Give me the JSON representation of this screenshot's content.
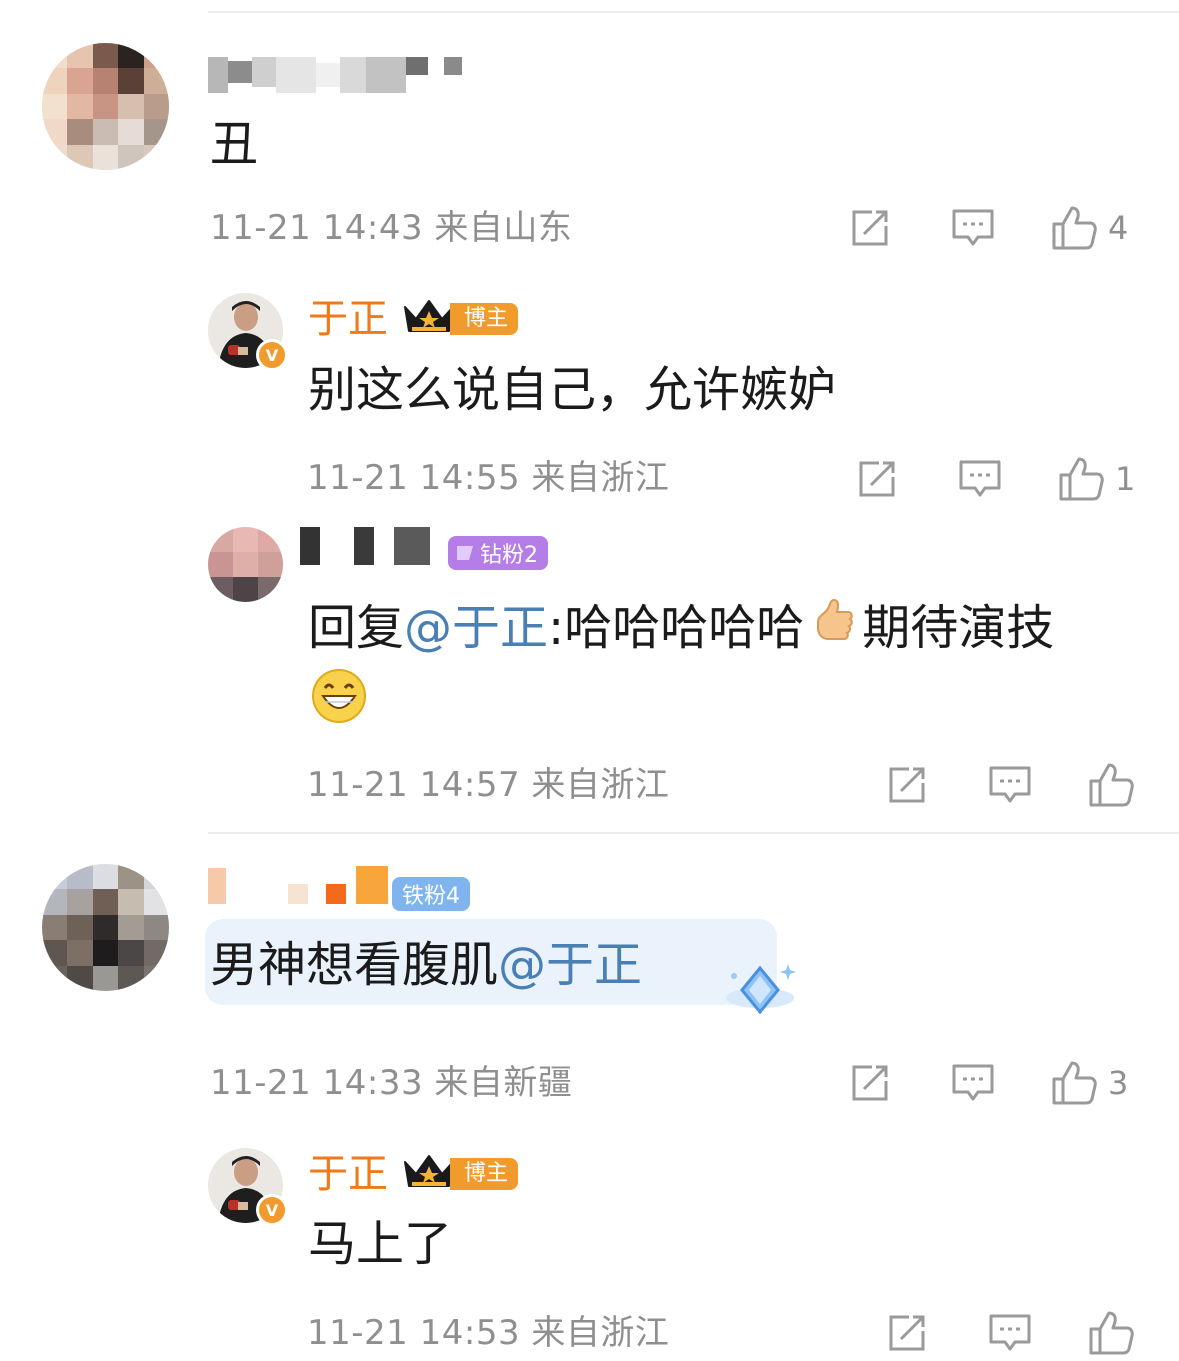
{
  "comments": [
    {
      "body": "丑",
      "meta": "11-21 14:43 来自山东",
      "like_count": "4"
    },
    {
      "author": "于正",
      "role_badge": "博主",
      "verified": "V",
      "body": "别这么说自己，允许嫉妒",
      "meta": "11-21 14:55 来自浙江",
      "like_count": "1"
    },
    {
      "fan_badge": "钻粉2",
      "body_prefix": "回复",
      "mention": "@于正",
      "body_rest": ":哈哈哈哈哈",
      "body_tail": "期待演技",
      "meta": "11-21 14:57 来自浙江",
      "like_count": ""
    },
    {
      "fan_badge": "铁粉4",
      "body": "男神想看腹肌",
      "mention": "@于正",
      "meta": "11-21 14:33 来自新疆",
      "like_count": "3"
    },
    {
      "author": "于正",
      "role_badge": "博主",
      "verified": "V",
      "body": "马上了",
      "meta": "11-21 14:53 来自浙江",
      "like_count": ""
    }
  ],
  "icons": {
    "share": "share-icon",
    "comment": "comment-icon",
    "like": "like-icon",
    "thumbs_up_emoji": "thumbs-up-emoji",
    "grin_emoji": "grin-emoji",
    "crown": "crown-icon",
    "diamond": "diamond-decoration-icon"
  },
  "colors": {
    "author_name": "#f07a1a",
    "mention": "#4a7fb5",
    "meta_text": "#8f8f8f",
    "role_badge": "#f29b2d",
    "diamond_fan_badge": "#b57de8",
    "iron_fan_badge": "#7fb4ee"
  }
}
